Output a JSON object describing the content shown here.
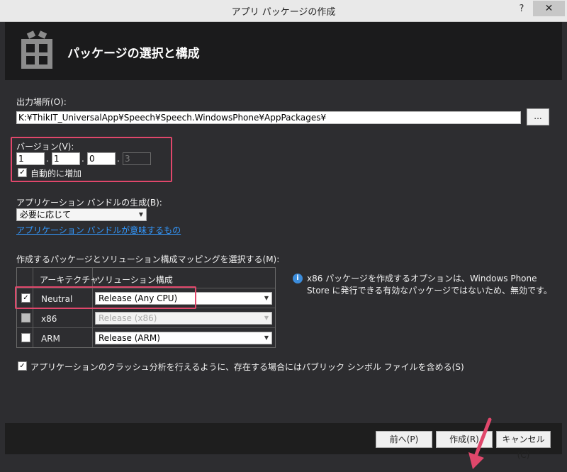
{
  "window": {
    "title": "アプリ パッケージの作成",
    "help_label": "?",
    "close_label": "✕"
  },
  "header": {
    "title": "パッケージの選択と構成",
    "icon": "gift-icon"
  },
  "output": {
    "label": "出力場所(O):",
    "value": "K:¥ThikIT_UniversalApp¥Speech¥Speech.WindowsPhone¥AppPackages¥",
    "browse_label": "..."
  },
  "version": {
    "label": "バージョン(V):",
    "parts": [
      "1",
      "1",
      "0",
      "3"
    ],
    "separator": ".",
    "auto_increment_label": "自動的に増加",
    "auto_increment_checked": true
  },
  "bundle": {
    "label": "アプリケーション バンドルの生成(B):",
    "selected": "必要に応じて",
    "link_text": "アプリケーション バンドルが意味するもの"
  },
  "mapping": {
    "label": "作成するパッケージとソリューション構成マッピングを選択する(M):",
    "columns": [
      "アーキテクチャ",
      "ソリューション構成"
    ],
    "rows": [
      {
        "arch": "Neutral",
        "config": "Release (Any CPU)",
        "checked": true,
        "enabled": true
      },
      {
        "arch": "x86",
        "config": "Release (x86)",
        "checked": false,
        "enabled": false
      },
      {
        "arch": "ARM",
        "config": "Release (ARM)",
        "checked": false,
        "enabled": true
      }
    ],
    "check_mark": "✓"
  },
  "info": {
    "icon": "info-icon",
    "icon_glyph": "i",
    "text": "x86 パッケージを作成するオプションは、Windows Phone Store に発行できる有効なパッケージではないため、無効です。"
  },
  "symbols": {
    "label": "アプリケーションのクラッシュ分析を行えるように、存在する場合にはパブリック シンボル ファイルを含める(S)",
    "checked": true
  },
  "buttons": {
    "prev": "前へ(P)",
    "create": "作成(R)",
    "cancel": "キャンセル(C)"
  },
  "colors": {
    "highlight": "#e0476b",
    "background": "#2d2d30",
    "header": "#1b1b1c",
    "link": "#3399ff"
  }
}
